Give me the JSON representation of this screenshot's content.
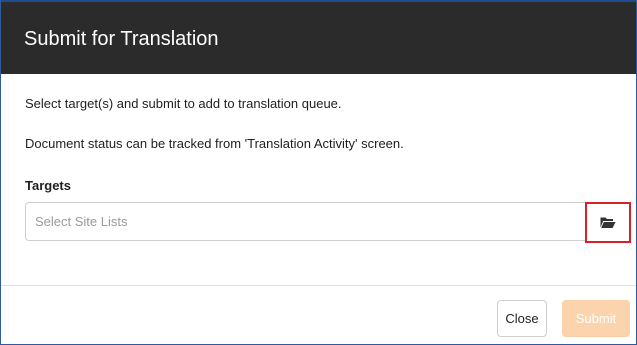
{
  "dialog": {
    "title": "Submit for Translation",
    "instructions": "Select target(s) and submit to add to translation queue.",
    "status_note": "Document status can be tracked from 'Translation Activity' screen.",
    "targets_label": "Targets",
    "targets_input": {
      "value": "",
      "placeholder": "Select Site Lists"
    },
    "browse_icon": "folder-open-icon",
    "close_label": "Close",
    "submit_label": "Submit",
    "submit_disabled": true,
    "colors": {
      "header_bg": "#2b2b2b",
      "highlight_border": "#d8202a",
      "submit_bg_disabled": "#fbd3ad"
    }
  }
}
